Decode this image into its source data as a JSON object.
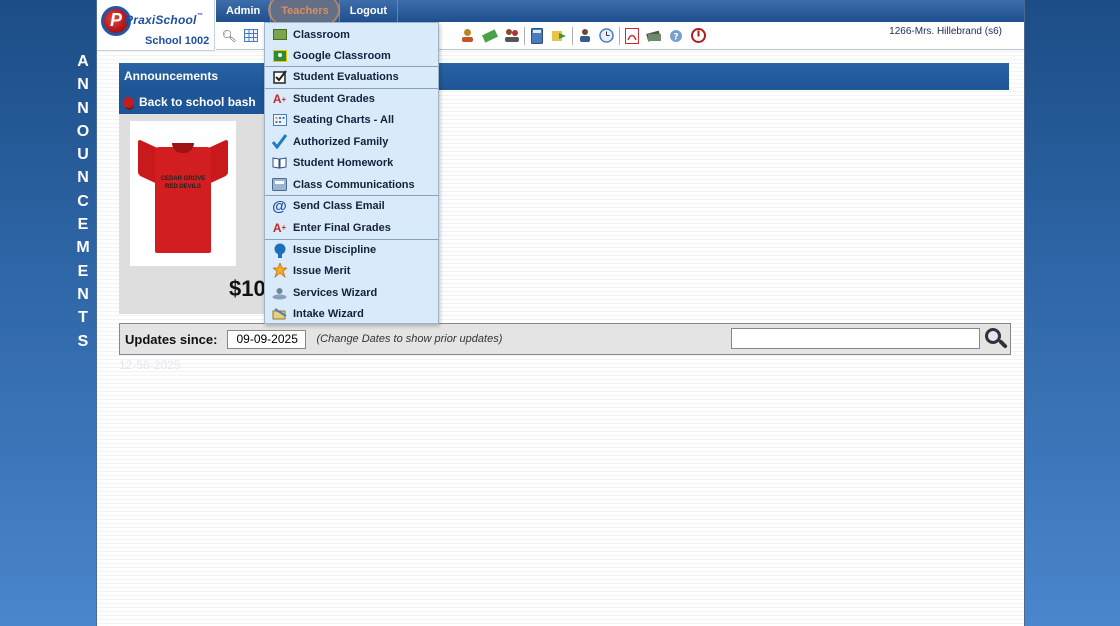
{
  "side_banner": [
    "A",
    "N",
    "N",
    "O",
    "U",
    "N",
    "C",
    "E",
    "M",
    "E",
    "N",
    "T",
    "S"
  ],
  "logo": {
    "brand": "PraxiSchool",
    "tm": "™",
    "school": "School 1002"
  },
  "nav": {
    "items": [
      "Admin",
      "Teachers",
      "Logout"
    ],
    "active": "Teachers"
  },
  "user": {
    "label": "1266-Mrs. Hillebrand (s6)"
  },
  "toolbar": {
    "icons": [
      "search-icon",
      "grid-icon",
      "info-icon",
      "teacher-icon",
      "money-icon",
      "group-icon",
      "calculator-icon",
      "arrow-icon",
      "people-icon",
      "clock-icon",
      "pdf-icon",
      "stack-icon",
      "help-icon",
      "power-icon"
    ]
  },
  "dropdown": {
    "items": [
      {
        "label": "Classroom",
        "icon": "classroom-icon"
      },
      {
        "label": "Google Classroom",
        "icon": "google-classroom-icon"
      },
      {
        "label": "Student Evaluations",
        "icon": "checkbox-icon"
      },
      {
        "label": "Student Grades",
        "icon": "grade-icon"
      },
      {
        "label": "Seating Charts - All",
        "icon": "seating-chart-icon"
      },
      {
        "label": "Authorized Family",
        "icon": "checkmark-icon"
      },
      {
        "label": "Student Homework",
        "icon": "book-icon"
      },
      {
        "label": "Class Communications",
        "icon": "communications-icon"
      },
      {
        "label": "Send Class Email",
        "icon": "at-icon"
      },
      {
        "label": "Enter Final Grades",
        "icon": "grade-icon"
      },
      {
        "label": "Issue Discipline",
        "icon": "discipline-icon"
      },
      {
        "label": "Issue Merit",
        "icon": "merit-icon"
      },
      {
        "label": "Services Wizard",
        "icon": "services-icon"
      },
      {
        "label": "Intake Wizard",
        "icon": "intake-icon"
      }
    ]
  },
  "announcements": {
    "header": "Announcements",
    "post_title": "Back to school bash",
    "shirt_text": "CEDAR GROVE RED DEVILS",
    "price": "$10"
  },
  "updates": {
    "label": "Updates since:",
    "date": "09-09-2025",
    "hint": "(Change Dates to show prior updates)",
    "search_value": ""
  },
  "footer": {
    "faded": "12-56-2025"
  },
  "colors": {
    "nav_blue": "#1f4f8e",
    "accent": "#d08860",
    "dropdown_bg": "#d9ebfa"
  }
}
